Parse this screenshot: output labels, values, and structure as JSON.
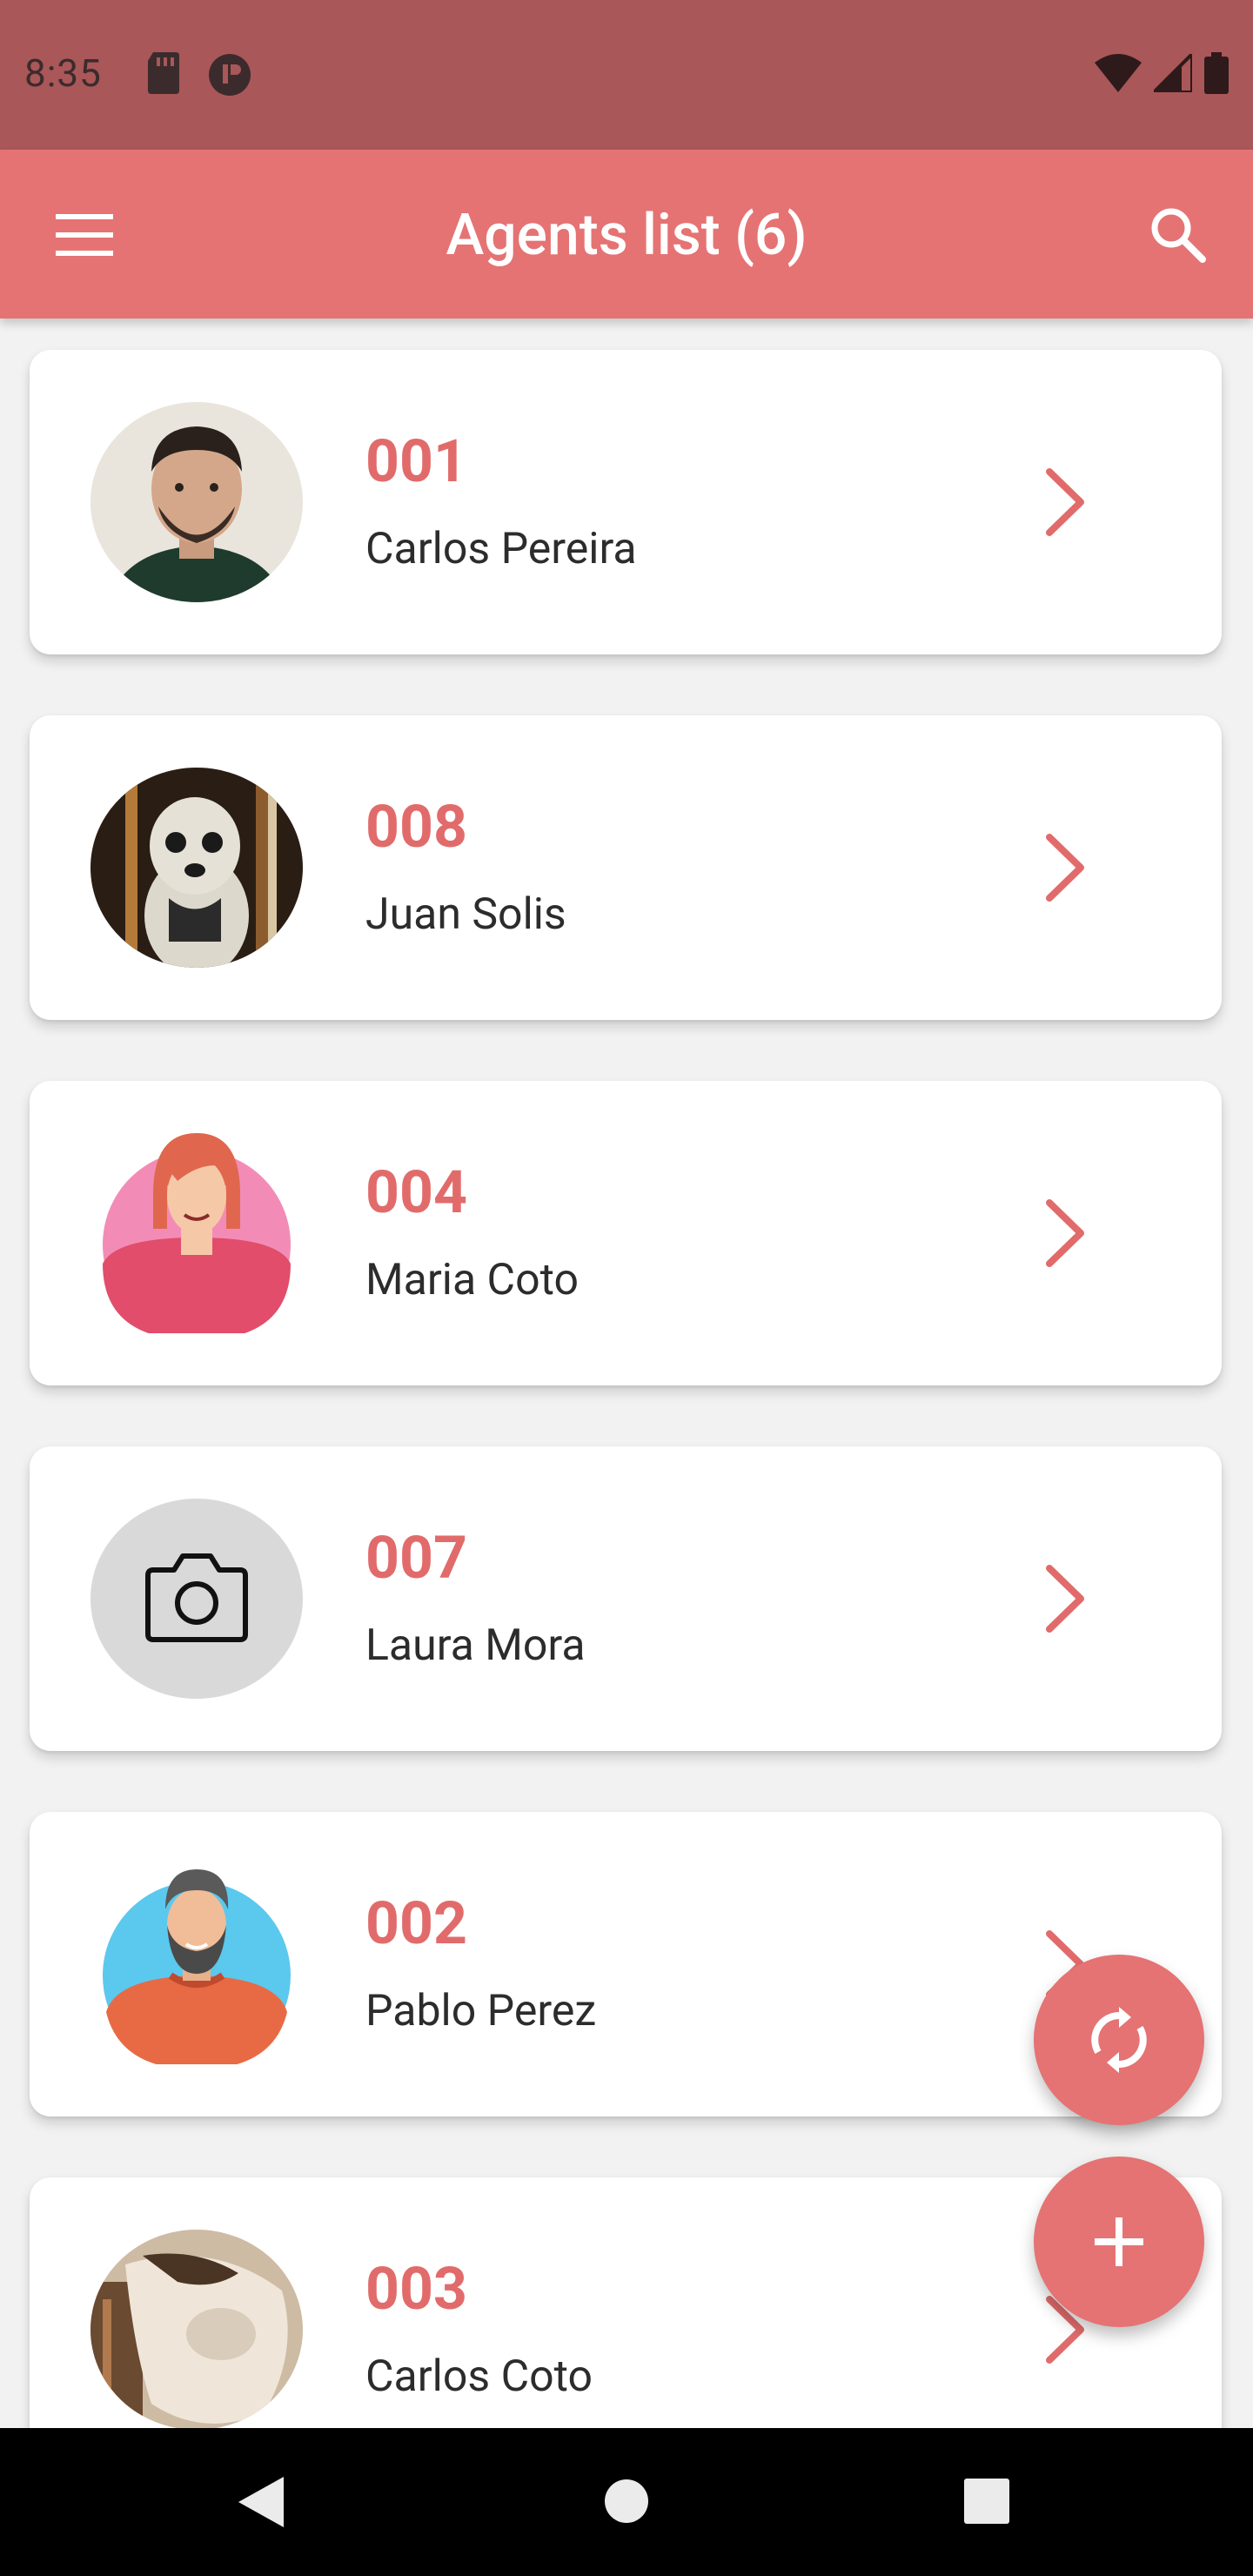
{
  "status_bar": {
    "time": "8:35",
    "icons_left": [
      "sd-card-icon",
      "at-icon"
    ],
    "icons_right": [
      "wifi-icon",
      "signal-icon",
      "battery-icon"
    ]
  },
  "app_bar": {
    "title": "Agents list (6)",
    "menu_icon": "menu-icon",
    "search_icon": "search-icon",
    "color": "#e57373"
  },
  "agents": [
    {
      "id": "001",
      "name": "Carlos Pereira",
      "avatar": "photo-man"
    },
    {
      "id": "008",
      "name": "Juan Solis",
      "avatar": "photo-dog"
    },
    {
      "id": "004",
      "name": "Maria Coto",
      "avatar": "illustration-woman"
    },
    {
      "id": "007",
      "name": "Laura Mora",
      "avatar": "camera-placeholder-icon"
    },
    {
      "id": "002",
      "name": "Pablo Perez",
      "avatar": "illustration-man"
    },
    {
      "id": "003",
      "name": "Carlos Coto",
      "avatar": "photo-dog-2"
    }
  ],
  "fabs": {
    "sync_icon": "sync-icon",
    "add_icon": "plus-icon"
  },
  "nav_bar": {
    "icons": [
      "back-icon",
      "home-icon",
      "recents-icon"
    ]
  }
}
